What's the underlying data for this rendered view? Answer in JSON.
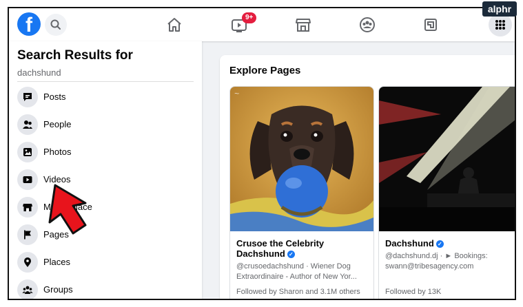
{
  "topbar": {
    "logo_letter": "f",
    "badge": "9+"
  },
  "watermark": "alphr",
  "sidebar": {
    "title": "Search Results for",
    "query": "dachshund",
    "items": [
      {
        "label": "Posts",
        "icon": "posts-icon"
      },
      {
        "label": "People",
        "icon": "people-icon"
      },
      {
        "label": "Photos",
        "icon": "photos-icon"
      },
      {
        "label": "Videos",
        "icon": "videos-icon"
      },
      {
        "label": "Marketplace",
        "icon": "marketplace-icon"
      },
      {
        "label": "Pages",
        "icon": "pages-icon"
      },
      {
        "label": "Places",
        "icon": "places-icon"
      },
      {
        "label": "Groups",
        "icon": "groups-icon"
      }
    ]
  },
  "main": {
    "section_title": "Explore Pages",
    "cards": [
      {
        "name": "Crusoe the Celebrity Dachshund",
        "description": "@crusoedachshund · Wiener Dog Extraordinaire - Author of New Yor...",
        "followed": "Followed by Sharon and 3.1M others"
      },
      {
        "name": "Dachshund",
        "description": "@dachshund.dj · ► Bookings: swann@tribesagency.com",
        "followed": "Followed by 13K"
      }
    ]
  },
  "colors": {
    "brand": "#1877f2",
    "badge": "#e41e3f",
    "arrow": "#e8141c"
  }
}
